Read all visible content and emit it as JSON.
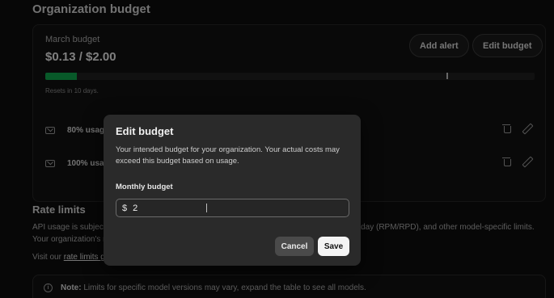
{
  "section": {
    "title": "Organization budget"
  },
  "budget": {
    "label": "March budget",
    "amount": "$0.13 / $2.00",
    "progress_fraction": 0.065,
    "threshold_fraction": 0.82,
    "accent": "#10a24b",
    "add_alert_label": "Add alert",
    "edit_budget_label": "Edit budget",
    "resets_text": "Resets in 10 days."
  },
  "alerts": [
    {
      "label": "80% usag",
      "icons": [
        "mail-icon",
        "trash-icon",
        "pencil-icon"
      ]
    },
    {
      "label": "100% usa",
      "icons": [
        "mail-icon",
        "trash-icon",
        "pencil-icon"
      ]
    }
  ],
  "rate_limits": {
    "title": "Rate limits",
    "line1_start": "API usage is subject",
    "line1_end": "r day (RPM/RPD), and other model-specific limits.",
    "line2": "Your organization's r",
    "line3_prefix": "Visit our ",
    "line3_link": "rate limits g",
    "note_strong": "Note:",
    "note_text": " Limits for specific model versions may vary, expand the table to see all models."
  },
  "modal": {
    "title": "Edit budget",
    "description": "Your intended budget for your organization. Your actual costs may exceed this budget based on usage.",
    "field_label": "Monthly budget",
    "currency": "$",
    "value": "2",
    "cancel_label": "Cancel",
    "save_label": "Save"
  }
}
